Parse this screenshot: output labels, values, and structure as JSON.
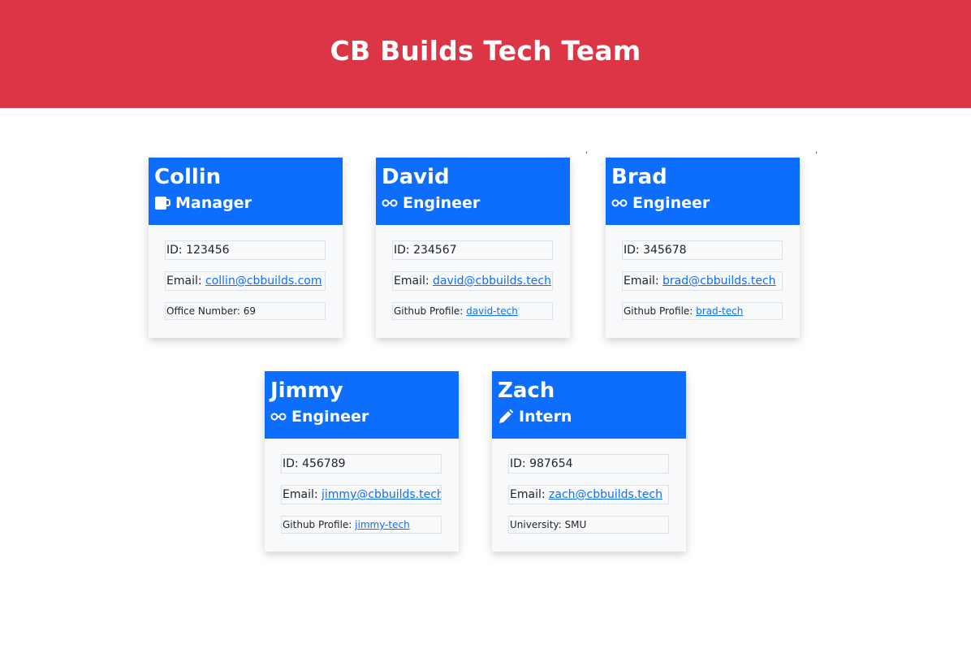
{
  "header": {
    "title": "CB Builds Tech Team"
  },
  "stray_marks": [
    ",",
    ","
  ],
  "labels": {
    "id": "ID: ",
    "email": "Email: ",
    "office": "Office Number: ",
    "github": "Github Profile: ",
    "school": "University: "
  },
  "colors": {
    "header_bg": "#dc3545",
    "card_header_bg": "#0d6efd"
  },
  "team": [
    {
      "name": "Collin",
      "role": "Manager",
      "icon": "mug-icon",
      "id": "123456",
      "email": "collin@cbbuilds.com",
      "extra_label": "office",
      "extra_value": "69"
    },
    {
      "name": "David",
      "role": "Engineer",
      "icon": "glasses-icon",
      "id": "234567",
      "email": "david@cbbuilds.tech",
      "extra_label": "github",
      "extra_value": "david-tech"
    },
    {
      "name": "Brad",
      "role": "Engineer",
      "icon": "glasses-icon",
      "id": "345678",
      "email": "brad@cbbuilds.tech",
      "extra_label": "github",
      "extra_value": "brad-tech"
    },
    {
      "name": "Jimmy",
      "role": "Engineer",
      "icon": "glasses-icon",
      "id": "456789",
      "email": "jimmy@cbbuilds.tech",
      "extra_label": "github",
      "extra_value": "jimmy-tech"
    },
    {
      "name": "Zach",
      "role": "Intern",
      "icon": "pencil-icon",
      "id": "987654",
      "email": "zach@cbbuilds.tech",
      "extra_label": "school",
      "extra_value": "SMU"
    }
  ]
}
